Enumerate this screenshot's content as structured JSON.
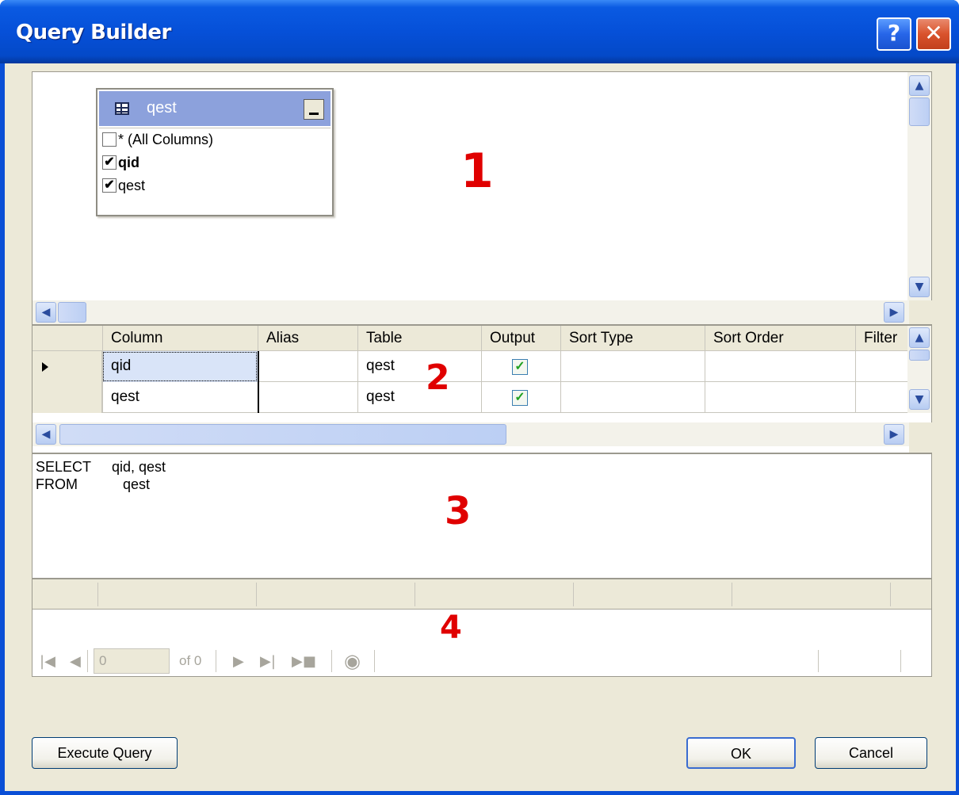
{
  "window": {
    "title": "Query Builder"
  },
  "titlebar": {
    "help_icon": "?",
    "close_icon": "✕"
  },
  "diagram": {
    "marker": "1",
    "table": {
      "name": "qest",
      "rows": [
        {
          "label": "* (All Columns)",
          "checked": false
        },
        {
          "label": "qid",
          "checked": true
        },
        {
          "label": "qest",
          "checked": true
        }
      ]
    }
  },
  "grid": {
    "marker": "2",
    "columns": [
      "Column",
      "Alias",
      "Table",
      "Output",
      "Sort Type",
      "Sort Order",
      "Filter"
    ],
    "rows": [
      {
        "column": "qid",
        "alias": "",
        "table": "qest",
        "output": true,
        "sort_type": "",
        "sort_order": "",
        "filter": ""
      },
      {
        "column": "qest",
        "alias": "",
        "table": "qest",
        "output": true,
        "sort_type": "",
        "sort_order": "",
        "filter": ""
      }
    ]
  },
  "sql": {
    "marker": "3",
    "lines": [
      {
        "keyword": "SELECT",
        "text": "qid, qest"
      },
      {
        "keyword": "FROM",
        "text": "qest"
      }
    ]
  },
  "results": {
    "marker": "4",
    "navigator": {
      "position": "0",
      "of_text": "of 0"
    }
  },
  "buttons": {
    "execute": "Execute Query",
    "ok": "OK",
    "cancel": "Cancel"
  }
}
